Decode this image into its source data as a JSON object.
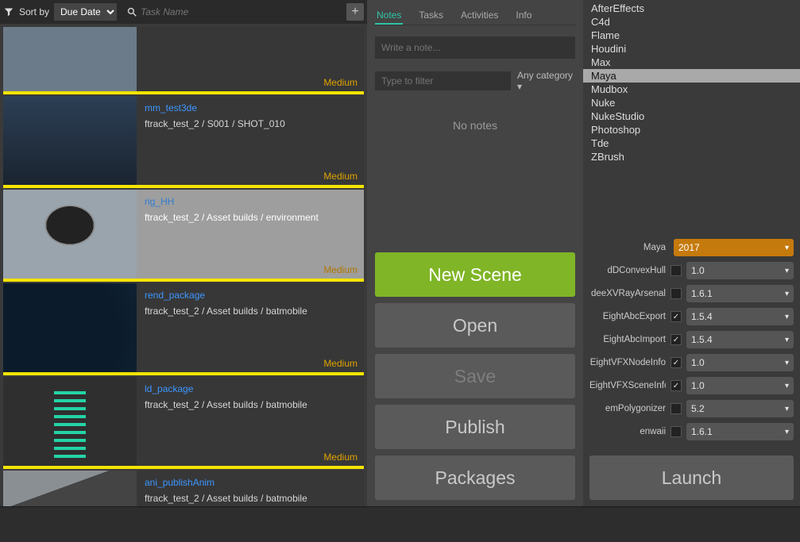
{
  "toolbar": {
    "sort_by_label": "Sort by",
    "sort_value": "Due Date",
    "search_placeholder": "Task Name"
  },
  "tasks": [
    {
      "title": "",
      "path": "",
      "priority": "Medium",
      "thumb": "grid",
      "partial": true
    },
    {
      "title": "mm_test3de",
      "path": "ftrack_test_2 / S001 / SHOT_010",
      "priority": "Medium",
      "thumb": "sky",
      "selected": false
    },
    {
      "title": "rig_HH",
      "path": "ftrack_test_2 / Asset builds / environment",
      "priority": "Medium",
      "thumb": "parachute",
      "selected": true
    },
    {
      "title": "rend_package",
      "path": "ftrack_test_2 / Asset builds / batmobile",
      "priority": "Medium",
      "thumb": "dark",
      "selected": false
    },
    {
      "title": "ld_package",
      "path": "ftrack_test_2 / Asset builds / batmobile",
      "priority": "Medium",
      "thumb": "spring",
      "selected": false
    },
    {
      "title": "ani_publishAnim",
      "path": "ftrack_test_2 / Asset builds / batmobile",
      "priority": "",
      "thumb": "house",
      "selected": false,
      "last": true
    }
  ],
  "mid": {
    "tabs": [
      "Notes",
      "Tasks",
      "Activities",
      "Info"
    ],
    "active_tab": 0,
    "note_placeholder": "Write a note...",
    "filter_placeholder": "Type to filter",
    "any_category": "Any category",
    "no_notes": "No notes"
  },
  "actions": {
    "new_scene": "New Scene",
    "open": "Open",
    "save": "Save",
    "publish": "Publish",
    "packages": "Packages"
  },
  "apps": {
    "items": [
      "AfterEffects",
      "C4d",
      "Flame",
      "Houdini",
      "Max",
      "Maya",
      "Mudbox",
      "Nuke",
      "NukeStudio",
      "Photoshop",
      "Tde",
      "ZBrush"
    ],
    "selected": "Maya"
  },
  "launcher": {
    "app_label": "Maya",
    "app_version": "2017",
    "plugins": [
      {
        "name": "dDConvexHull",
        "checked": false,
        "version": "1.0"
      },
      {
        "name": "deeXVRayArsenal",
        "checked": false,
        "version": "1.6.1"
      },
      {
        "name": "EightAbcExport",
        "checked": true,
        "version": "1.5.4"
      },
      {
        "name": "EightAbcImport",
        "checked": true,
        "version": "1.5.4"
      },
      {
        "name": "EightVFXNodeInfo",
        "checked": true,
        "version": "1.0"
      },
      {
        "name": "EightVFXSceneInfo",
        "checked": true,
        "version": "1.0"
      },
      {
        "name": "emPolygonizer",
        "checked": false,
        "version": "5.2"
      },
      {
        "name": "enwaii",
        "checked": false,
        "version": "1.6.1"
      }
    ],
    "launch_label": "Launch"
  }
}
